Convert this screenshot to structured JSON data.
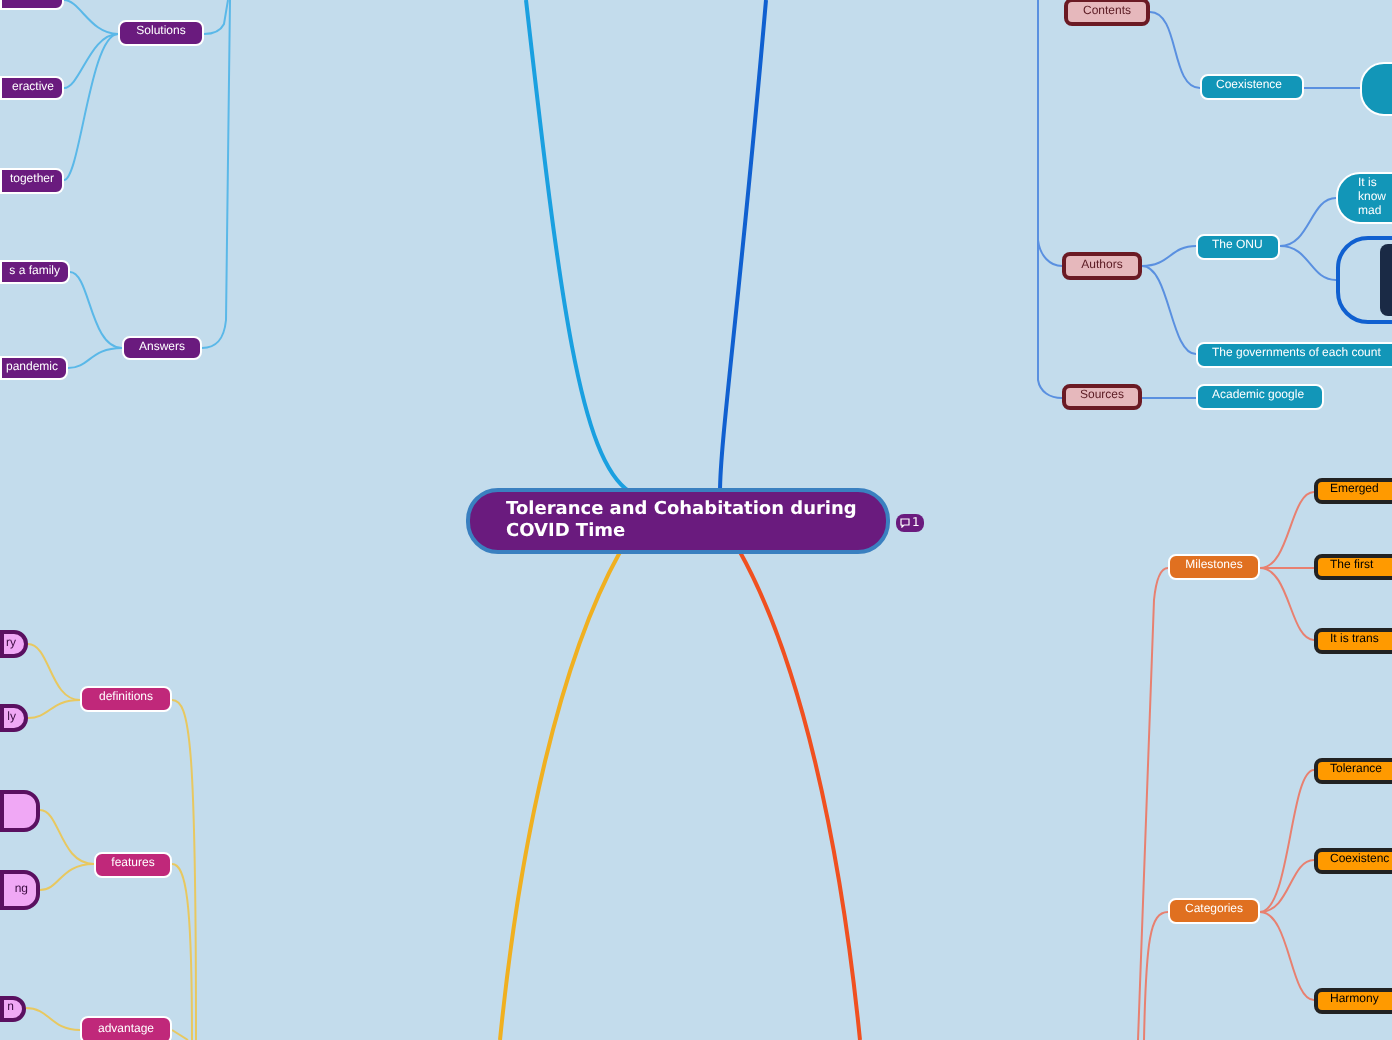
{
  "central_topic": {
    "title": "Tolerance and Cohabitation during COVID Time",
    "comments": "1"
  },
  "nodes": [
    {
      "kind": "purple_leaf"
    },
    {
      "kind": "purple",
      "label": "Solutions"
    },
    {
      "kind": "purple_leaf",
      "label": "eractive"
    },
    {
      "kind": "purple_leaf",
      "label": "together"
    },
    {
      "kind": "purple_leaf",
      "label": "s a family"
    },
    {
      "kind": "purple",
      "label": "Answers"
    },
    {
      "kind": "purple_leaf",
      "label": "pandemic"
    },
    {
      "kind": "rose",
      "label": "Contents"
    },
    {
      "kind": "teal",
      "label": "Coexistence"
    },
    {
      "kind": "teal_round"
    },
    {
      "kind": "rose",
      "label": "Authors"
    },
    {
      "kind": "teal",
      "label": "The ONU"
    },
    {
      "kind": "teal_round",
      "label": "It is\nknow\nmad"
    },
    {
      "kind": "photo"
    },
    {
      "kind": "teal",
      "label": "The governments of each count"
    },
    {
      "kind": "rose",
      "label": "Sources"
    },
    {
      "kind": "teal",
      "label": "Academic google"
    },
    {
      "kind": "orange",
      "label": "Milestones"
    },
    {
      "kind": "orange_leaf",
      "label": "Emerged"
    },
    {
      "kind": "orange_leaf",
      "label": "The first"
    },
    {
      "kind": "orange_leaf",
      "label": "It is trans"
    },
    {
      "kind": "orange",
      "label": "Categories"
    },
    {
      "kind": "orange_leaf",
      "label": "Tolerance"
    },
    {
      "kind": "orange_leaf",
      "label": "Coexistenc"
    },
    {
      "kind": "orange_leaf",
      "label": "Harmony"
    },
    {
      "kind": "pink_leaf",
      "label": "ry"
    },
    {
      "kind": "magenta",
      "label": "definitions"
    },
    {
      "kind": "pink_leaf",
      "label": "ly"
    },
    {
      "kind": "pink_leaf"
    },
    {
      "kind": "magenta",
      "label": "features"
    },
    {
      "kind": "pink_leaf",
      "label": "ng"
    },
    {
      "kind": "pink_leaf",
      "label": "n"
    },
    {
      "kind": "magenta",
      "label": "advantage"
    }
  ]
}
